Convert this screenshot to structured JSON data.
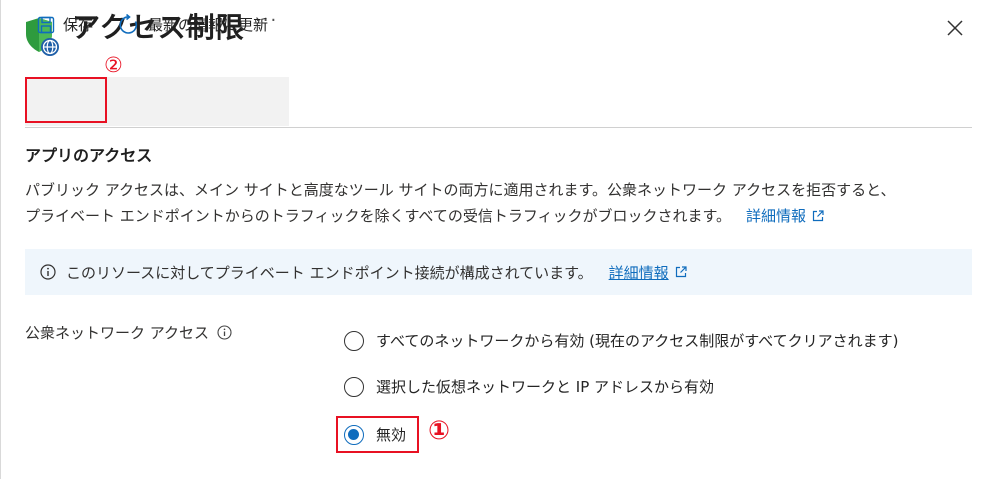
{
  "header": {
    "title": "アクセス制限",
    "more_label": "···",
    "logo_icon": "shield-globe-icon",
    "close_icon": "close-icon"
  },
  "annotations": {
    "step_save": "②",
    "step_disabled": "①",
    "highlight_color": "#e81123"
  },
  "toolbar": {
    "save_label": "保存",
    "refresh_label": "最新の情報に更新"
  },
  "section": {
    "title": "アプリのアクセス",
    "description_line1": "パブリック アクセスは、メイン サイトと高度なツール サイトの両方に適用されます。公衆ネットワーク アクセスを拒否すると、",
    "description_line2": "プライベート エンドポイントからのトラフィックを除くすべての受信トラフィックがブロックされます。",
    "learn_more": "詳細情報"
  },
  "info_bar": {
    "text": "このリソースに対してプライベート エンドポイント接続が構成されています。",
    "learn_more": "詳細情報"
  },
  "public_network_access": {
    "label": "公衆ネットワーク アクセス",
    "options": [
      {
        "label": "すべてのネットワークから有効 (現在のアクセス制限がすべてクリアされます)",
        "selected": false
      },
      {
        "label": "選択した仮想ネットワークと IP アドレスから有効",
        "selected": false
      },
      {
        "label": "無効",
        "selected": true
      }
    ]
  },
  "colors": {
    "accent": "#0f6cbd",
    "info_bg": "#eff6fc",
    "toolbar_bg": "#f2f2f2"
  }
}
